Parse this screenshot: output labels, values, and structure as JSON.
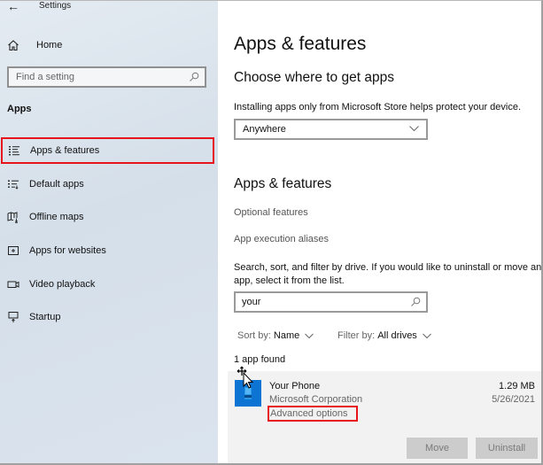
{
  "window": {
    "title": "Settings",
    "back_icon": "back-arrow-icon"
  },
  "sidebar": {
    "home": {
      "label": "Home",
      "icon": "home-icon"
    },
    "search": {
      "placeholder": "Find a setting",
      "value": "",
      "icon": "search-icon"
    },
    "section": "Apps",
    "items": [
      {
        "label": "Apps & features",
        "icon": "apps-features-icon",
        "selected": true
      },
      {
        "label": "Default apps",
        "icon": "default-apps-icon",
        "selected": false
      },
      {
        "label": "Offline maps",
        "icon": "offline-maps-icon",
        "selected": false
      },
      {
        "label": "Apps for websites",
        "icon": "apps-for-websites-icon",
        "selected": false
      },
      {
        "label": "Video playback",
        "icon": "video-playback-icon",
        "selected": false
      },
      {
        "label": "Startup",
        "icon": "startup-icon",
        "selected": false
      }
    ]
  },
  "main": {
    "title": "Apps & features",
    "choose": {
      "heading": "Choose where to get apps",
      "description": "Installing apps only from Microsoft Store helps protect your device.",
      "dropdown_value": "Anywhere"
    },
    "apps_features": {
      "heading": "Apps & features",
      "links": [
        "Optional features",
        "App execution aliases"
      ],
      "description": "Search, sort, and filter by drive. If you would like to uninstall or move an app, select it from the list.",
      "search_value": "your",
      "sort_label": "Sort by:",
      "sort_value": "Name",
      "filter_label": "Filter by:",
      "filter_value": "All drives",
      "count_text": "1 app found"
    },
    "apps": [
      {
        "name": "Your Phone",
        "publisher": "Microsoft Corporation",
        "advanced_link": "Advanced options",
        "size": "1.29 MB",
        "date": "5/26/2021",
        "icon_color": "#0d74d4",
        "move_label": "Move",
        "uninstall_label": "Uninstall"
      }
    ]
  },
  "colors": {
    "highlight": "#e8141c",
    "sidebar_bg": "#dbe4ee",
    "app_icon": "#0d74d4",
    "button_disabled": "#cccccc"
  }
}
